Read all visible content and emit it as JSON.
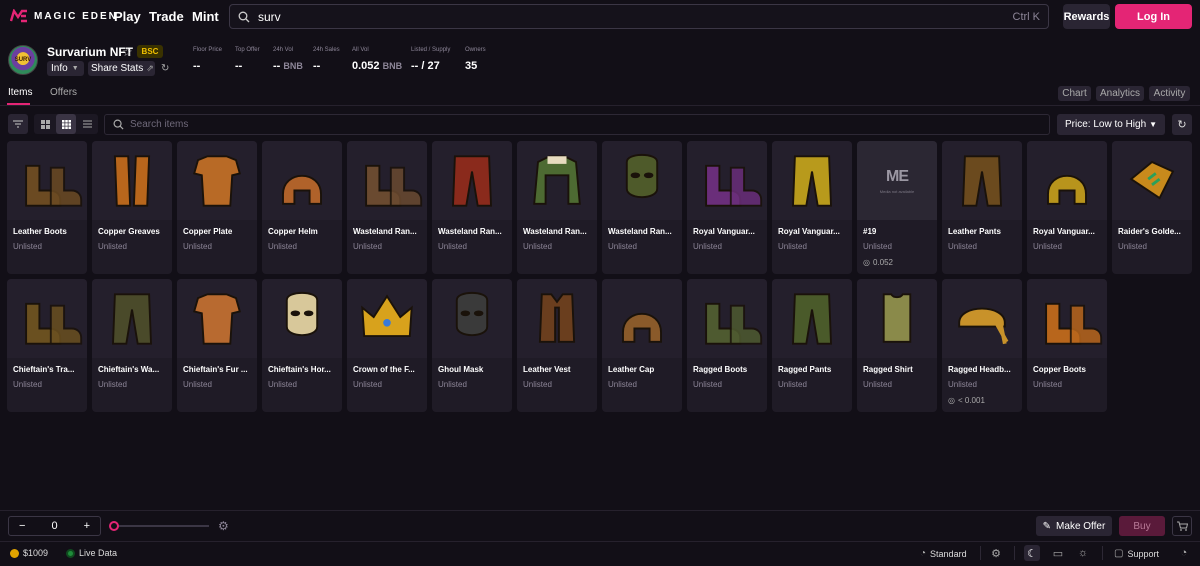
{
  "brand": {
    "name": "MAGIC EDEN",
    "accent": "#e42575"
  },
  "nav": {
    "links": [
      "Play",
      "Trade",
      "Mint"
    ]
  },
  "search": {
    "query": "surv",
    "shortcut": "Ctrl  K"
  },
  "header_buttons": {
    "rewards": "Rewards",
    "login": "Log In"
  },
  "collection": {
    "name": "Survarium NFT",
    "chain": "BSC",
    "info_label": "Info",
    "share_label": "Share Stats",
    "stats": [
      {
        "label": "Floor Price",
        "value": "--",
        "unit": ""
      },
      {
        "label": "Top Offer",
        "value": "--",
        "unit": ""
      },
      {
        "label": "24h Vol",
        "value": "--",
        "unit": "BNB"
      },
      {
        "label": "24h Sales",
        "value": "--",
        "unit": ""
      },
      {
        "label": "All Vol",
        "value": "0.052",
        "unit": "BNB"
      },
      {
        "label": "Listed / Supply",
        "value": "-- / 27",
        "unit": ""
      },
      {
        "label": "Owners",
        "value": "35",
        "unit": ""
      }
    ]
  },
  "tabs": {
    "items": "Items",
    "offers": "Offers",
    "chart": "Chart",
    "analytics": "Analytics",
    "activity": "Activity"
  },
  "toolbar": {
    "search_placeholder": "Search items",
    "sort": "Price: Low to High"
  },
  "items": [
    {
      "name": "Leather Boots",
      "status": "Unlisted",
      "price": "",
      "icon": "boots-icon",
      "color": "#6b4a22"
    },
    {
      "name": "Copper Greaves",
      "status": "Unlisted",
      "price": "",
      "icon": "greaves-icon",
      "color": "#b8661c"
    },
    {
      "name": "Copper Plate",
      "status": "Unlisted",
      "price": "",
      "icon": "chestplate-icon",
      "color": "#b86a26"
    },
    {
      "name": "Copper Helm",
      "status": "Unlisted",
      "price": "",
      "icon": "helm-icon",
      "color": "#b0622a"
    },
    {
      "name": "Wasteland Ran...",
      "status": "Unlisted",
      "price": "",
      "icon": "boots-icon",
      "color": "#6a4a30"
    },
    {
      "name": "Wasteland Ran...",
      "status": "Unlisted",
      "price": "",
      "icon": "pants-icon",
      "color": "#8a2a1c"
    },
    {
      "name": "Wasteland Ran...",
      "status": "Unlisted",
      "price": "",
      "icon": "coat-icon",
      "color": "#4d6a32"
    },
    {
      "name": "Wasteland Ran...",
      "status": "Unlisted",
      "price": "",
      "icon": "mask-icon",
      "color": "#4e5a2a"
    },
    {
      "name": "Royal Vanguar...",
      "status": "Unlisted",
      "price": "",
      "icon": "boots-icon",
      "color": "#6a2e7a"
    },
    {
      "name": "Royal Vanguar...",
      "status": "Unlisted",
      "price": "",
      "icon": "pants-icon",
      "color": "#b89a1c"
    },
    {
      "name": "#19",
      "status": "Unlisted",
      "price": "0.052",
      "icon": "placeholder",
      "color": "#2b2733",
      "placeholder_logo": "ME",
      "placeholder_text": "Media not available"
    },
    {
      "name": "Leather Pants",
      "status": "Unlisted",
      "price": "",
      "icon": "pants-icon",
      "color": "#6b4a1e"
    },
    {
      "name": "Royal Vanguar...",
      "status": "Unlisted",
      "price": "",
      "icon": "helm-icon",
      "color": "#b8941c"
    },
    {
      "name": "Raider's Golde...",
      "status": "Unlisted",
      "price": "",
      "icon": "whistle-icon",
      "color": "#c88a1c"
    },
    {
      "name": "Chieftain's Tra...",
      "status": "Unlisted",
      "price": "",
      "icon": "boots-icon",
      "color": "#6a5020"
    },
    {
      "name": "Chieftain's Wa...",
      "status": "Unlisted",
      "price": "",
      "icon": "pants-icon",
      "color": "#4a4a2a"
    },
    {
      "name": "Chieftain's Fur ...",
      "status": "Unlisted",
      "price": "",
      "icon": "chestplate-icon",
      "color": "#b86a30"
    },
    {
      "name": "Chieftain's Hor...",
      "status": "Unlisted",
      "price": "",
      "icon": "mask-icon",
      "color": "#d8c89a"
    },
    {
      "name": "Crown of the F...",
      "status": "Unlisted",
      "price": "",
      "icon": "crown-icon",
      "color": "#d8a21c"
    },
    {
      "name": "Ghoul Mask",
      "status": "Unlisted",
      "price": "",
      "icon": "mask-icon",
      "color": "#3a3a3a"
    },
    {
      "name": "Leather Vest",
      "status": "Unlisted",
      "price": "",
      "icon": "vest-icon",
      "color": "#6a3e1e"
    },
    {
      "name": "Leather Cap",
      "status": "Unlisted",
      "price": "",
      "icon": "helm-icon",
      "color": "#8a5a2a"
    },
    {
      "name": "Ragged Boots",
      "status": "Unlisted",
      "price": "",
      "icon": "boots-icon",
      "color": "#4e5a30"
    },
    {
      "name": "Ragged Pants",
      "status": "Unlisted",
      "price": "",
      "icon": "pants-icon",
      "color": "#4a5a2a"
    },
    {
      "name": "Ragged Shirt",
      "status": "Unlisted",
      "price": "",
      "icon": "shirt-icon",
      "color": "#8a8a4a"
    },
    {
      "name": "Ragged Headb...",
      "status": "Unlisted",
      "price": "< 0.001",
      "icon": "headband-icon",
      "color": "#c8922a"
    },
    {
      "name": "Copper Boots",
      "status": "Unlisted",
      "price": "",
      "icon": "boots-icon",
      "color": "#b8661c"
    }
  ],
  "bottom": {
    "quantity": "0",
    "minus": "−",
    "plus": "+",
    "make_offer": "Make Offer",
    "buy": "Buy"
  },
  "footer": {
    "balance": "$1009",
    "live": "Live Data",
    "mode": "Standard",
    "support": "Support"
  }
}
